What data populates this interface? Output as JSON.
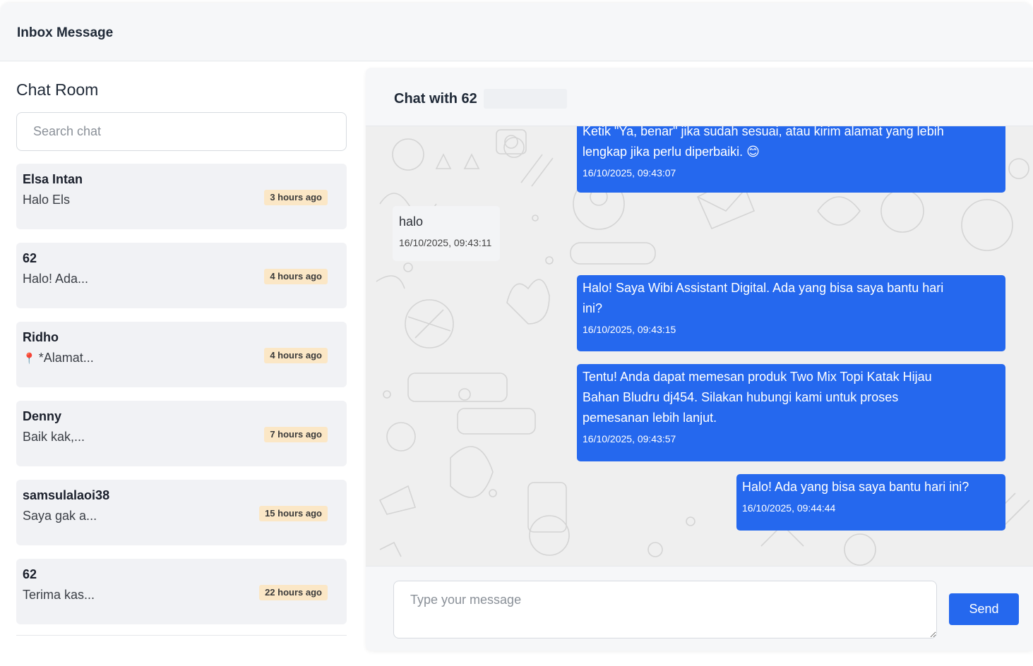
{
  "header": {
    "title": "Inbox Message"
  },
  "sidebar": {
    "title": "Chat Room",
    "search_placeholder": "Search chat",
    "chats": [
      {
        "name": "Elsa Intan",
        "preview": "Halo Els",
        "time": "3 hours ago"
      },
      {
        "name": "62",
        "preview": "Halo! Ada...",
        "time": "4 hours ago"
      },
      {
        "name": "Ridho",
        "preview": "*Alamat...",
        "time": "4 hours ago",
        "icon": "pin-icon"
      },
      {
        "name": "Denny",
        "preview": "Baik kak,...",
        "time": "7 hours ago"
      },
      {
        "name": "samsulalaoi38",
        "preview": "Saya gak a...",
        "time": "15 hours ago"
      },
      {
        "name": "62",
        "preview": "Terima kas...",
        "time": "22 hours ago"
      }
    ]
  },
  "chat": {
    "title": "Chat with 62",
    "messages": [
      {
        "direction": "out",
        "lines": [
          "Ketik \"Ya, benar\" jika sudah sesuai, atau kirim alamat yang lebih",
          "lengkap jika perlu diperbaiki. 😊"
        ],
        "time": "16/10/2025, 09:43:07"
      },
      {
        "direction": "in",
        "lines": [
          "halo"
        ],
        "time": "16/10/2025, 09:43:11"
      },
      {
        "direction": "out",
        "lines": [
          "Halo! Saya Wibi Assistant Digital. Ada yang bisa saya bantu hari",
          "ini?"
        ],
        "time": "16/10/2025, 09:43:15"
      },
      {
        "direction": "out",
        "lines": [
          "Tentu! Anda dapat memesan produk Two Mix Topi Katak Hijau",
          "Bahan Bludru dj454. Silakan hubungi kami untuk proses",
          "pemesanan lebih lanjut."
        ],
        "time": "16/10/2025, 09:43:57"
      },
      {
        "direction": "out",
        "lines": [
          "Halo! Ada yang bisa saya bantu hari ini?"
        ],
        "time": "16/10/2025, 09:44:44"
      }
    ],
    "input_placeholder": "Type your message",
    "send_label": "Send"
  },
  "colors": {
    "accent": "#2568ee",
    "badge": "#fbe7c6",
    "card": "#f1f2f5",
    "chat_background": "#efefef"
  }
}
